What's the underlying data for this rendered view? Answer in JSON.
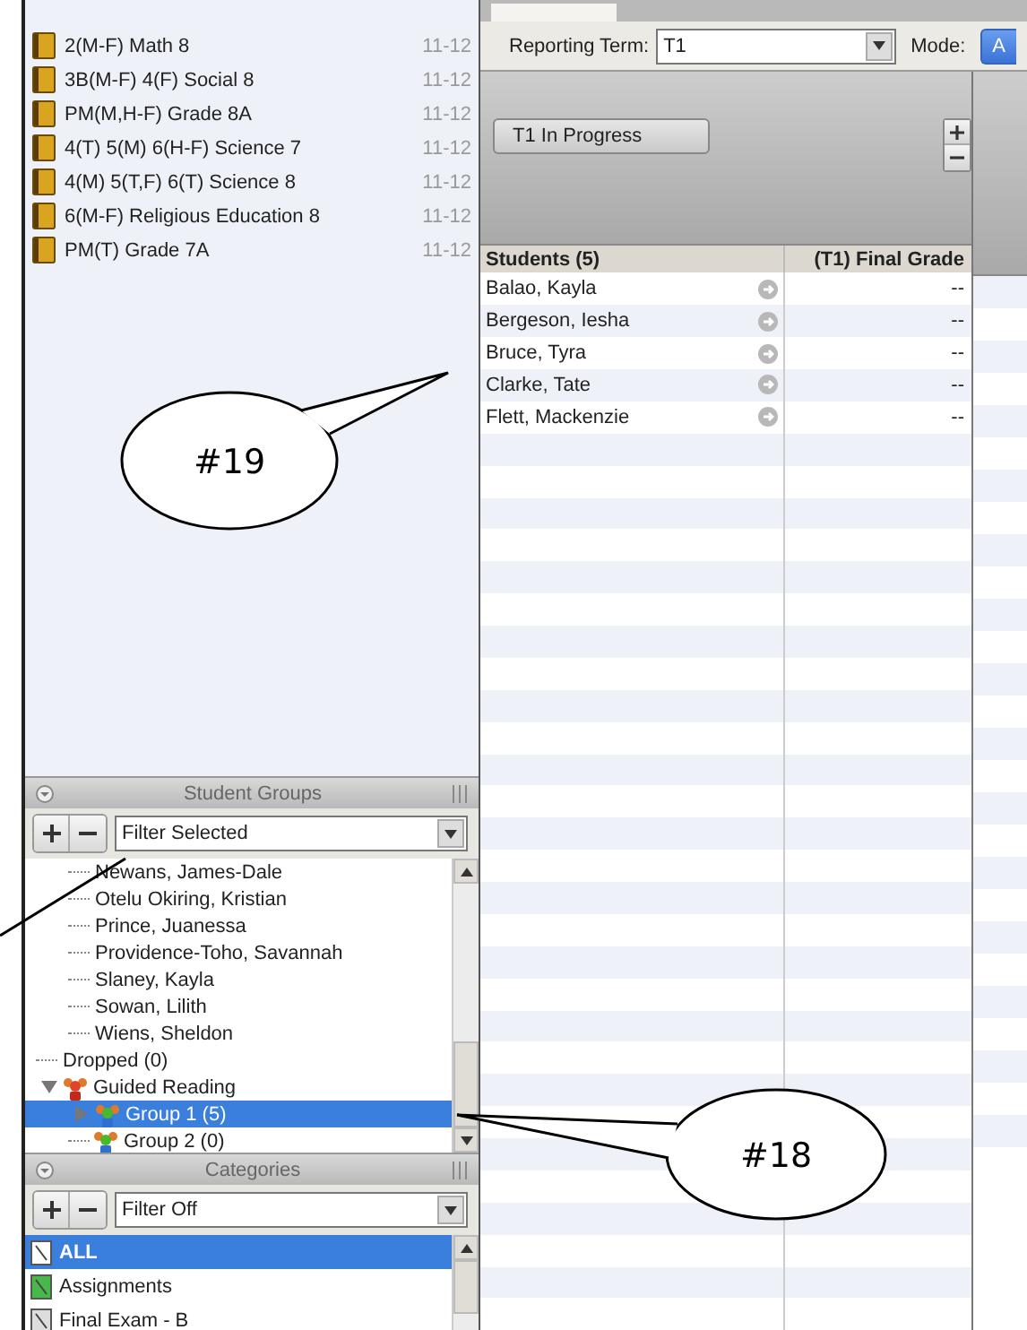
{
  "courses": [
    {
      "name": "2(M-F) Math 8",
      "year": "11-12"
    },
    {
      "name": "3B(M-F) 4(F) Social 8",
      "year": "11-12"
    },
    {
      "name": "PM(M,H-F) Grade 8A",
      "year": "11-12"
    },
    {
      "name": "4(T) 5(M) 6(H-F) Science 7",
      "year": "11-12"
    },
    {
      "name": "4(M) 5(T,F) 6(T) Science 8",
      "year": "11-12"
    },
    {
      "name": "6(M-F) Religious Education 8",
      "year": "11-12"
    },
    {
      "name": "PM(T) Grade 7A",
      "year": "11-12"
    }
  ],
  "student_groups": {
    "title": "Student Groups",
    "filter": "Filter Selected",
    "tree": [
      {
        "children": [
          {
            "label": "Newans, James-Dale",
            "selected": false
          },
          {
            "label": "Otelu Okiring, Kristian",
            "selected": false
          },
          {
            "label": "Prince, Juanessa",
            "selected": false
          },
          {
            "label": "Providence-Toho, Savannah",
            "selected": false
          },
          {
            "label": "Slaney, Kayla",
            "selected": false
          },
          {
            "label": "Sowan, Lilith",
            "selected": false
          },
          {
            "label": "Wiens, Sheldon",
            "selected": false
          }
        ]
      },
      {
        "label": "Dropped (0)",
        "selected": false
      },
      {
        "label": "Guided Reading",
        "kind": "group",
        "expanded": true,
        "selected": false,
        "children": [
          {
            "label": "Group 1 (5)",
            "kind": "subgroup",
            "expanded": false,
            "selected": true
          },
          {
            "label": "Group 2 (0)",
            "kind": "subgroup",
            "selected": false
          }
        ]
      }
    ]
  },
  "categories": {
    "title": "Categories",
    "filter": "Filter Off",
    "items": [
      {
        "label": "ALL",
        "kind": "all",
        "selected": true
      },
      {
        "label": "Assignments",
        "kind": "assignments",
        "selected": false
      },
      {
        "label": "Final Exam - B",
        "kind": "exam",
        "selected": false
      }
    ]
  },
  "toolbar": {
    "term_label": "Reporting Term:",
    "term": "T1",
    "mode_label": "Mode:",
    "mode_button": "A"
  },
  "term_button": "T1 In Progress",
  "table": {
    "columns": [
      "Students (5)",
      "(T1) Final Grade"
    ],
    "rows": [
      {
        "student": "Balao, Kayla",
        "grade": "--"
      },
      {
        "student": "Bergeson, Iesha",
        "grade": "--"
      },
      {
        "student": "Bruce, Tyra",
        "grade": "--"
      },
      {
        "student": "Clarke, Tate",
        "grade": "--"
      },
      {
        "student": "Flett, Mackenzie",
        "grade": "--"
      }
    ]
  },
  "callouts": [
    "#19",
    "#18"
  ]
}
